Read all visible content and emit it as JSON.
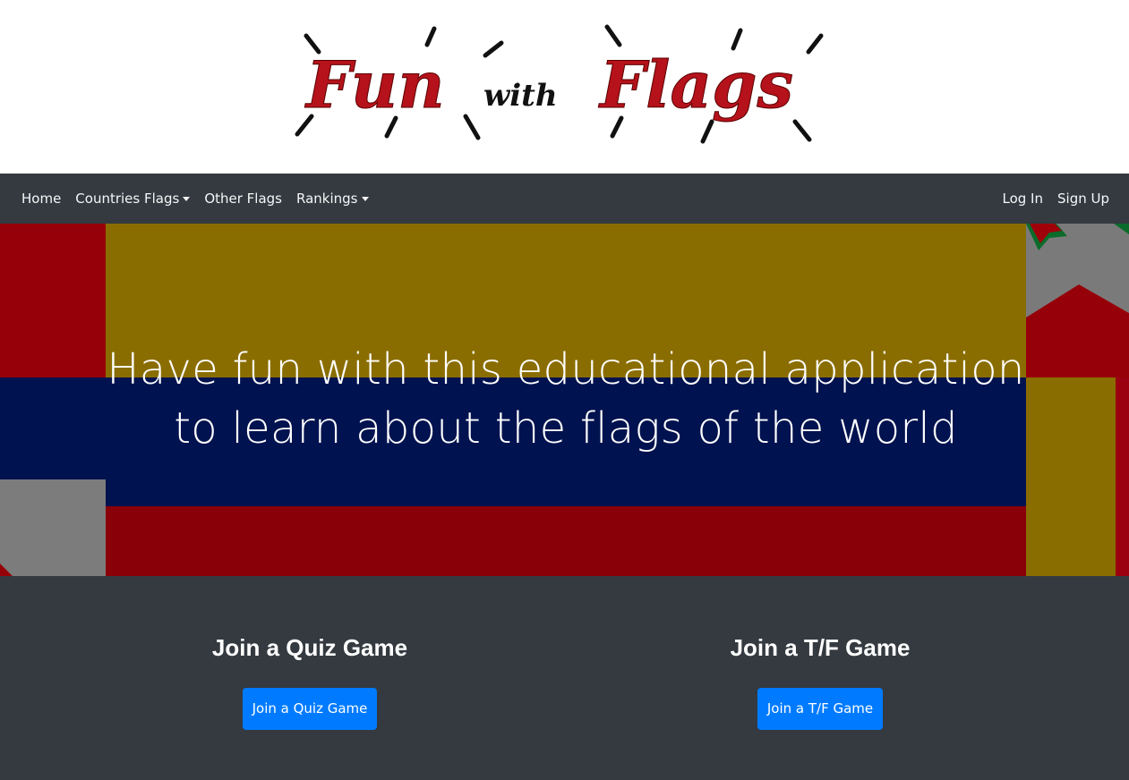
{
  "logo": {
    "word1": "Fun",
    "word2": "with",
    "word3": "Flags"
  },
  "nav": {
    "left": [
      {
        "label": "Home",
        "dropdown": false
      },
      {
        "label": "Countries Flags",
        "dropdown": true
      },
      {
        "label": "Other Flags",
        "dropdown": false
      },
      {
        "label": "Rankings",
        "dropdown": true
      }
    ],
    "right": [
      {
        "label": "Log In"
      },
      {
        "label": "Sign Up"
      }
    ]
  },
  "hero": {
    "line1": "Have fun with this educational application",
    "line2": "to learn about the flags of the world"
  },
  "games": {
    "quiz": {
      "title": "Join a Quiz Game",
      "button": "Join a Quiz Game"
    },
    "tf": {
      "title": "Join a T/F Game",
      "button": "Join a T/F Game"
    }
  },
  "colors": {
    "navbar": "#343a40",
    "primary_button": "#007bff",
    "logo_red": "#b5121b",
    "hero_gold": "#8a6d00",
    "hero_navy": "#00124f",
    "hero_red": "#8a0008"
  }
}
